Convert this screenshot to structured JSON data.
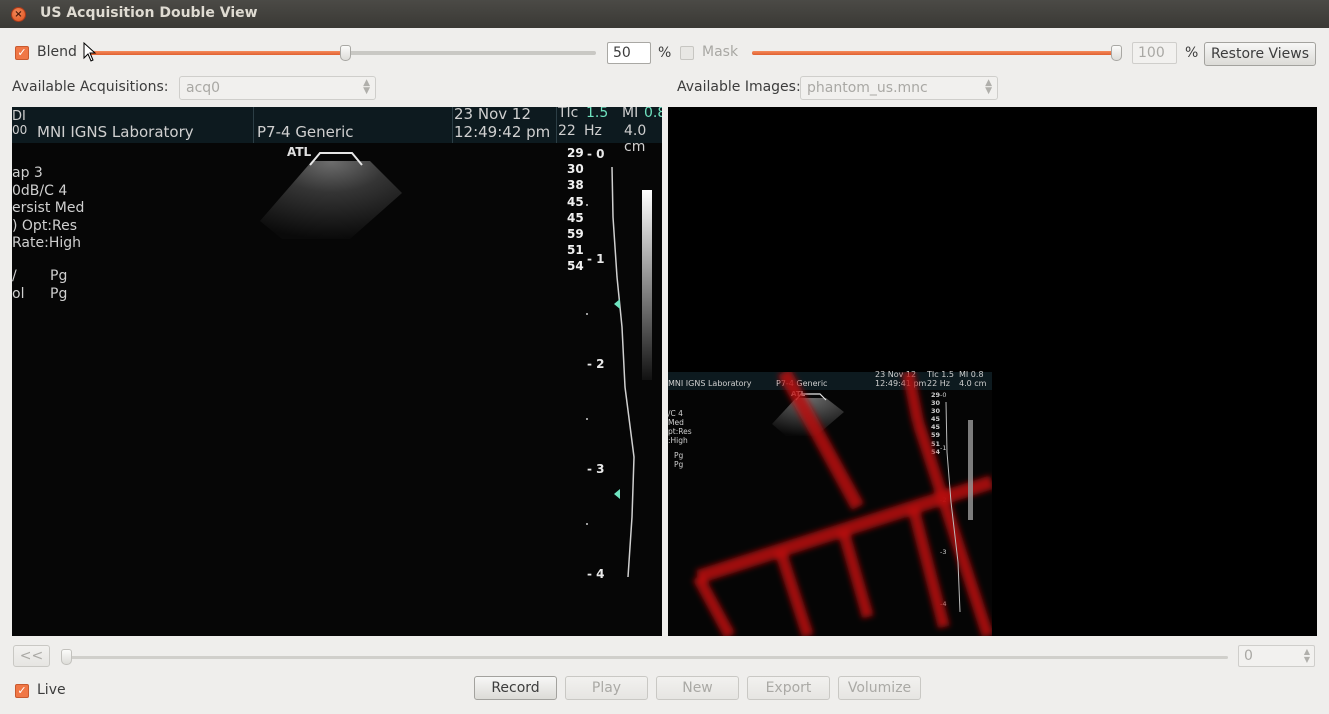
{
  "window": {
    "title": "US Acquisition Double View"
  },
  "blend": {
    "label": "Blend",
    "checked": true,
    "value": 50,
    "value_text": "50",
    "unit": "%"
  },
  "mask": {
    "label": "Mask",
    "checked": false,
    "value": 100,
    "value_text": "100",
    "unit": "%"
  },
  "restore_views_label": "Restore Views",
  "acquisitions": {
    "label": "Available Acquisitions:",
    "selected": "acq0"
  },
  "images": {
    "label": "Available Images:",
    "selected": "phantom_us.mnc"
  },
  "ultrasound": {
    "header_left": "MNI IGNS Laboratory",
    "header_left_edge": "DI",
    "header_left_edge2": "00",
    "probe": "P7-4 Generic",
    "date": "23 Nov 12",
    "time": "12:49:42 pm",
    "tic_label": "TIc",
    "tic_value": "1.5",
    "mi_label": "MI",
    "mi_value": "0.8",
    "hz_value": "22",
    "hz_unit": "Hz",
    "depth_value": "4.0 cm",
    "atl": "ATL",
    "side_params": [
      "ap 3",
      "0dB/C 4",
      "ersist Med",
      ") Opt:Res",
      " Rate:High"
    ],
    "side_params2": [
      [
        "/",
        "Pg"
      ],
      [
        "ol",
        "Pg"
      ]
    ],
    "gray_values": [
      "29",
      "30",
      "38",
      "45",
      "45",
      "59",
      "51",
      "54"
    ],
    "depth_marks": [
      "0",
      "1",
      "2",
      "3",
      "4"
    ]
  },
  "overlay_view": {
    "header_left": "MNI IGNS Laboratory",
    "probe": "P7-4 Generic",
    "date": "23 Nov 12",
    "time": "12:49:41 pm",
    "tic": "TIc 1.5",
    "mi": "MI 0.8",
    "hz": "22 Hz",
    "depth": "4.0 cm",
    "atl": "ATL",
    "side_params": [
      "/C 4",
      "Med",
      "pt:Res",
      ":High"
    ],
    "pg": [
      "Pg",
      "Pg"
    ],
    "gray_values": [
      "29",
      "30",
      "30",
      "45",
      "45",
      "59",
      "51",
      "54"
    ],
    "depth_marks": [
      "0",
      "1",
      "2",
      "3",
      "4"
    ]
  },
  "playback": {
    "rewind_label": "<<",
    "frame_value": "0",
    "live_label": "Live",
    "live_checked": true,
    "buttons": {
      "record": "Record",
      "play": "Play",
      "new": "New",
      "export": "Export",
      "volumize": "Volumize"
    }
  }
}
